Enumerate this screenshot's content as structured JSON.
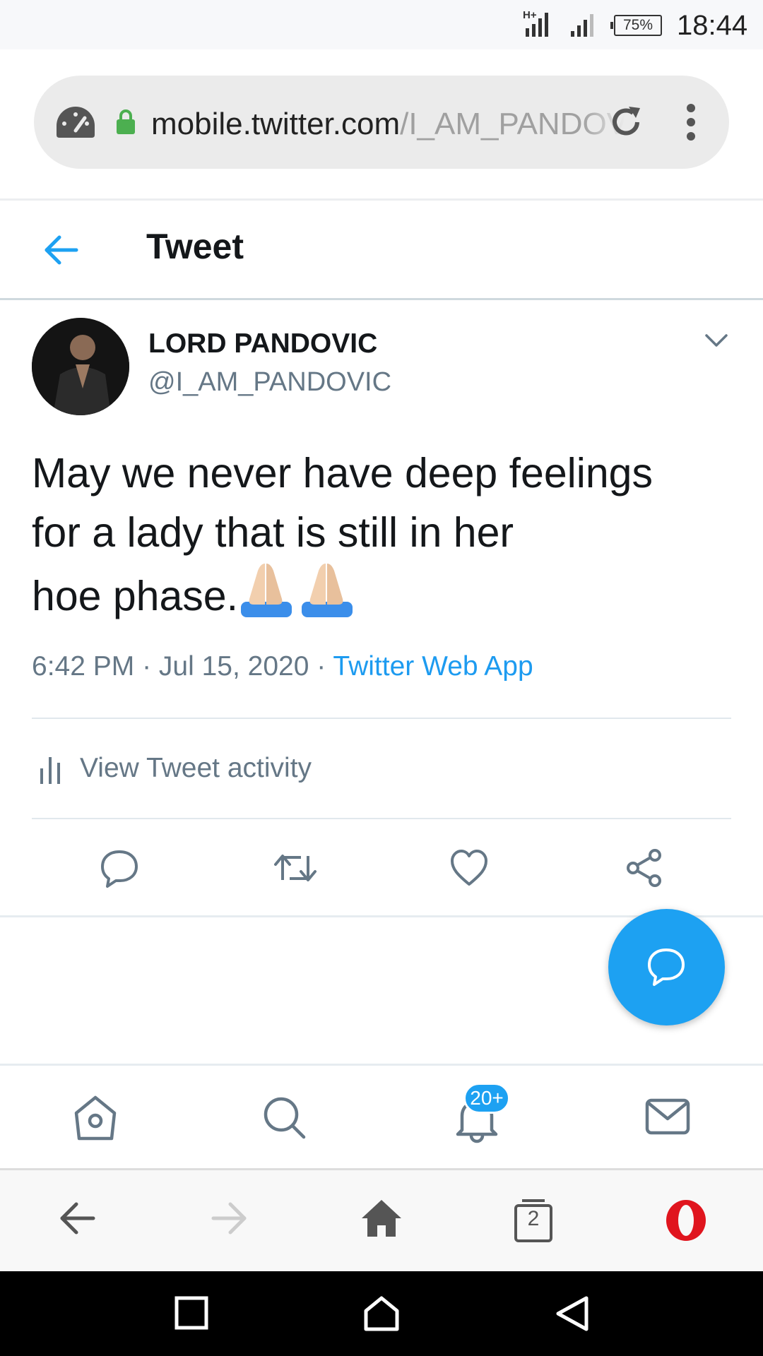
{
  "status_bar": {
    "battery": "75%",
    "time": "18:44",
    "network": "H+"
  },
  "browser": {
    "url_host": "mobile.twitter.com",
    "url_path": "/I_AM_PANDOVIC",
    "tab_count": "2"
  },
  "header": {
    "title": "Tweet"
  },
  "tweet": {
    "author_name": "LORD PANDOVIC",
    "author_handle": "@I_AM_PANDOVIC",
    "text_line1": "May we never have deep feelings",
    "text_line2": "for a lady that is still in her",
    "text_line3": "hoe phase.",
    "time": "6:42 PM",
    "date": "Jul 15, 2020",
    "source": "Twitter Web App",
    "activity_label": "View Tweet activity"
  },
  "bottom_nav": {
    "notifications_badge": "20+"
  },
  "colors": {
    "accent": "#1da1f2",
    "text": "#14171a",
    "secondary": "#657786"
  }
}
